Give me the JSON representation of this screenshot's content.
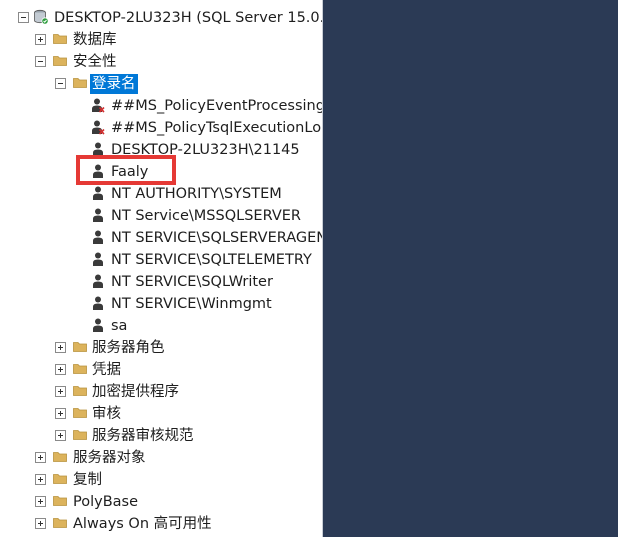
{
  "tree": {
    "server": "DESKTOP-2LU323H (SQL Server 15.0.",
    "databases": "数据库",
    "security": "安全性",
    "logins": "登录名",
    "login_items": [
      "##MS_PolicyEventProcessing",
      "##MS_PolicyTsqlExecutionLo",
      "DESKTOP-2LU323H\\21145",
      "Faaly",
      "NT AUTHORITY\\SYSTEM",
      "NT Service\\MSSQLSERVER",
      "NT SERVICE\\SQLSERVERAGEN",
      "NT SERVICE\\SQLTELEMETRY",
      "NT SERVICE\\SQLWriter",
      "NT SERVICE\\Winmgmt",
      "sa"
    ],
    "security_children": [
      "服务器角色",
      "凭据",
      "加密提供程序",
      "审核",
      "服务器审核规范"
    ],
    "server_children": [
      "服务器对象",
      "复制",
      "PolyBase",
      "Always On 高可用性"
    ]
  },
  "colors": {
    "selection": "#0078d7",
    "highlight": "#e53935",
    "folder": "#dcb35c",
    "background": "#2b3a55"
  },
  "icons": {
    "server": "server-icon",
    "folder": "folder-icon",
    "user": "user-icon",
    "disabled_user": "disabled-user-icon"
  }
}
